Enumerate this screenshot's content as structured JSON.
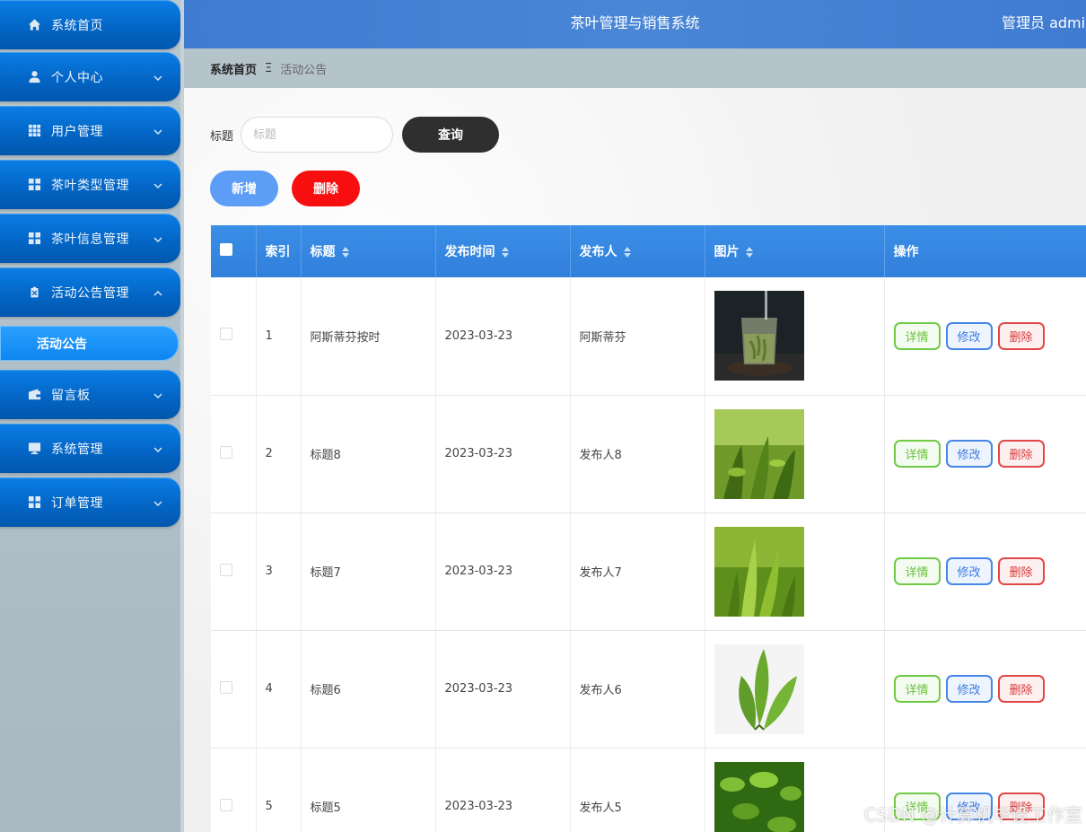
{
  "header": {
    "title": "茶叶管理与销售系统",
    "user": "管理员 admin"
  },
  "sidebar": {
    "items": [
      {
        "label": "系统首页",
        "icon": "home-icon",
        "has_chevron": false,
        "chevron": ""
      },
      {
        "label": "个人中心",
        "icon": "user-icon",
        "has_chevron": true,
        "chevron": "down"
      },
      {
        "label": "用户管理",
        "icon": "grid-icon",
        "has_chevron": true,
        "chevron": "down"
      },
      {
        "label": "茶叶类型管理",
        "icon": "apps-icon",
        "has_chevron": true,
        "chevron": "down"
      },
      {
        "label": "茶叶信息管理",
        "icon": "apps-icon",
        "has_chevron": true,
        "chevron": "down"
      },
      {
        "label": "活动公告管理",
        "icon": "clipboard-icon",
        "has_chevron": true,
        "chevron": "up"
      },
      {
        "label": "留言板",
        "icon": "wallet-icon",
        "has_chevron": true,
        "chevron": "down"
      },
      {
        "label": "系统管理",
        "icon": "monitor-icon",
        "has_chevron": true,
        "chevron": "down"
      },
      {
        "label": "订单管理",
        "icon": "apps-icon",
        "has_chevron": true,
        "chevron": "down"
      }
    ],
    "sub_item": "活动公告"
  },
  "breadcrumb": {
    "home": "系统首页",
    "separator": "Ξ",
    "current": "活动公告"
  },
  "search": {
    "label": "标题",
    "placeholder": "标题",
    "value": "",
    "button": "查询"
  },
  "actions": {
    "add": "新增",
    "delete": "删除"
  },
  "table": {
    "headers": {
      "index": "索引",
      "title": "标题",
      "time": "发布时间",
      "publisher": "发布人",
      "image": "图片",
      "ops": "操作"
    },
    "rows": [
      {
        "index": "1",
        "title": "阿斯蒂芬按时",
        "time": "2023-03-23",
        "publisher": "阿斯蒂芬",
        "image": "tea-glass"
      },
      {
        "index": "2",
        "title": "标题8",
        "time": "2023-03-23",
        "publisher": "发布人8",
        "image": "tea-field"
      },
      {
        "index": "3",
        "title": "标题7",
        "time": "2023-03-23",
        "publisher": "发布人7",
        "image": "tea-sprout"
      },
      {
        "index": "4",
        "title": "标题6",
        "time": "2023-03-23",
        "publisher": "发布人6",
        "image": "tea-leaves"
      },
      {
        "index": "5",
        "title": "标题5",
        "time": "2023-03-23",
        "publisher": "发布人5",
        "image": "tea-bush"
      }
    ],
    "op_labels": {
      "detail": "详情",
      "edit": "修改",
      "delete": "删除"
    }
  },
  "watermark": "CSDN @计算机毕设工作室",
  "colors": {
    "sidebar_blue": "#0366c6",
    "header_blue": "#4a86d6",
    "table_head": "#3a8ee6",
    "delete_red": "#f70f0f",
    "add_blue": "#5c9ef5"
  }
}
